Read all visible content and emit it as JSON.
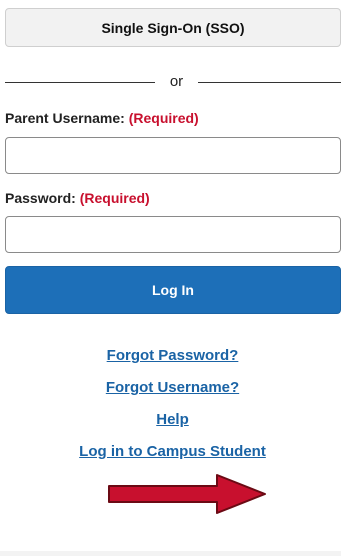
{
  "sso": {
    "label": "Single Sign-On (SSO)"
  },
  "divider": {
    "text": "or"
  },
  "username": {
    "label": "Parent Username:",
    "required": "(Required)",
    "value": "",
    "placeholder": ""
  },
  "password": {
    "label": "Password:",
    "required": "(Required)",
    "value": "",
    "placeholder": ""
  },
  "login": {
    "label": "Log In"
  },
  "links": [
    {
      "label": "Forgot Password?"
    },
    {
      "label": "Forgot Username?"
    },
    {
      "label": "Help"
    },
    {
      "label": "Log in to Campus Student"
    }
  ],
  "colors": {
    "primary": "#1d6fb8",
    "link": "#1a63a5",
    "required": "#c8102e",
    "arrow": "#c8102e"
  },
  "annotation": {
    "icon": "right-arrow-icon"
  }
}
